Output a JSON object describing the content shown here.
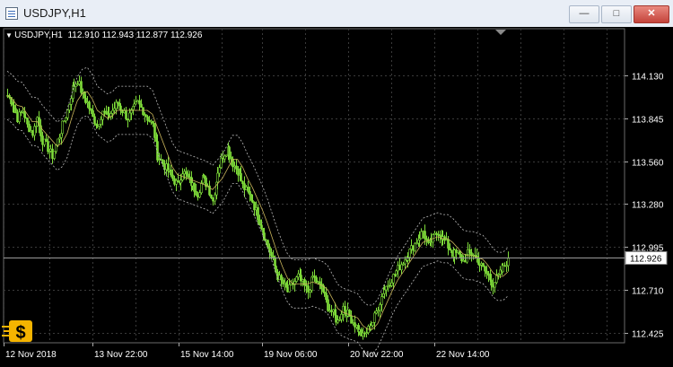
{
  "window": {
    "title": "USDJPY,H1",
    "minimize_label": "—",
    "maximize_label": "□",
    "close_label": "✕"
  },
  "chart_header": {
    "symbol": "USDJPY,H1",
    "ohlc": "112.910 112.943 112.877 112.926"
  },
  "chart_data": {
    "type": "candlestick",
    "symbol": "USDJPY",
    "timeframe": "H1",
    "last_price": "112.926",
    "y_ticks": [
      "114.130",
      "113.845",
      "113.560",
      "113.280",
      "112.995",
      "112.710",
      "112.425"
    ],
    "y_tick_values": [
      114.13,
      113.845,
      113.56,
      113.28,
      112.995,
      112.71,
      112.425
    ],
    "x_ticks": [
      "12 Nov 2018",
      "13 Nov 22:00",
      "15 Nov 14:00",
      "19 Nov 06:00",
      "20 Nov 22:00",
      "22 Nov 14:00"
    ],
    "ylim": [
      112.36,
      114.37
    ],
    "grid": true,
    "indicators": [
      "bollinger-bands",
      "moving-average"
    ],
    "closes": [
      114.0,
      113.95,
      113.85,
      113.9,
      113.8,
      113.75,
      113.85,
      113.7,
      113.65,
      113.6,
      113.7,
      113.8,
      113.9,
      114.05,
      114.1,
      114.0,
      113.95,
      113.85,
      113.8,
      113.9,
      113.85,
      113.9,
      113.95,
      113.9,
      113.85,
      113.9,
      113.95,
      113.9,
      113.85,
      113.8,
      113.6,
      113.55,
      113.5,
      113.45,
      113.4,
      113.5,
      113.45,
      113.4,
      113.35,
      113.45,
      113.4,
      113.3,
      113.5,
      113.6,
      113.65,
      113.55,
      113.5,
      113.4,
      113.35,
      113.3,
      113.2,
      113.1,
      113.0,
      112.9,
      112.8,
      112.75,
      112.7,
      112.75,
      112.8,
      112.75,
      112.7,
      112.8,
      112.75,
      112.7,
      112.6,
      112.55,
      112.5,
      112.6,
      112.55,
      112.5,
      112.45,
      112.4,
      112.45,
      112.5,
      112.6,
      112.7,
      112.75,
      112.8,
      112.85,
      112.9,
      112.95,
      113.0,
      113.05,
      113.1,
      113.0,
      113.05,
      113.1,
      113.05,
      113.0,
      112.95,
      112.95,
      112.9,
      112.95,
      112.95,
      112.9,
      112.85,
      112.8,
      112.75,
      112.8,
      112.85,
      112.92
    ]
  }
}
